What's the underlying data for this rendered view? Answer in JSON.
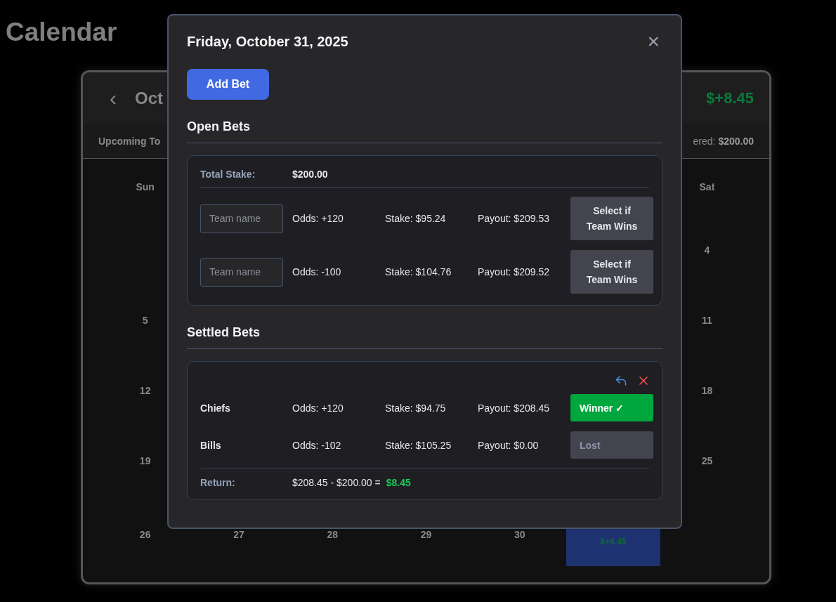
{
  "page": {
    "title": "Calendar"
  },
  "calendar": {
    "prev_button": "‹",
    "month_title": "Oct",
    "total_profit": "$+8.45",
    "upcoming_label": "Upcoming To",
    "wagered_label": "ered:",
    "wagered_value": "$200.00",
    "weekdays": {
      "sun": "Sun",
      "sat": "Sat"
    },
    "weeks": [
      {
        "sat": {
          "day": "4"
        }
      },
      {
        "sun": {
          "day": "5"
        },
        "sat": {
          "day": "11"
        }
      },
      {
        "sun": {
          "day": "12"
        },
        "sat": {
          "day": "18"
        }
      },
      {
        "sun": {
          "day": "19"
        },
        "sat": {
          "day": "25"
        }
      },
      {
        "sun": {
          "day": "26"
        },
        "mon": {
          "day": "27"
        },
        "tue": {
          "day": "28"
        },
        "wed": {
          "day": "29"
        },
        "thu": {
          "day": "30"
        },
        "fri": {
          "profit": "$+8.45",
          "selected": true
        }
      }
    ]
  },
  "dialog": {
    "title": "Friday, October 31, 2025",
    "close": "×",
    "add_button": "Add Bet",
    "open_bets": {
      "heading": "Open Bets",
      "total_stake_label": "Total Stake:",
      "total_stake": "$200.00",
      "bets": [
        {
          "team_placeholder": "Team name",
          "odds": "Odds: +120",
          "stake": "Stake: $95.24",
          "payout": "Payout: $209.53",
          "button": "Select if Team Wins"
        },
        {
          "team_placeholder": "Team name",
          "odds": "Odds: -100",
          "stake": "Stake: $104.76",
          "payout": "Payout: $209.52",
          "button": "Select if Team Wins"
        }
      ]
    },
    "settled_bets": {
      "heading": "Settled Bets",
      "bets": [
        {
          "team": "Chiefs",
          "odds": "Odds: +120",
          "stake": "Stake: $94.75",
          "payout": "Payout: $208.45",
          "result": {
            "kind": "winner",
            "label": "Winner ✓"
          }
        },
        {
          "team": "Bills",
          "odds": "Odds: -102",
          "stake": "Stake: $105.25",
          "payout": "Payout: $0.00",
          "result": {
            "kind": "lost",
            "label": "Lost"
          }
        }
      ],
      "return_label": "Return:",
      "return_equation": "$208.45 - $200.00 =",
      "return_amount": "$8.45"
    }
  }
}
